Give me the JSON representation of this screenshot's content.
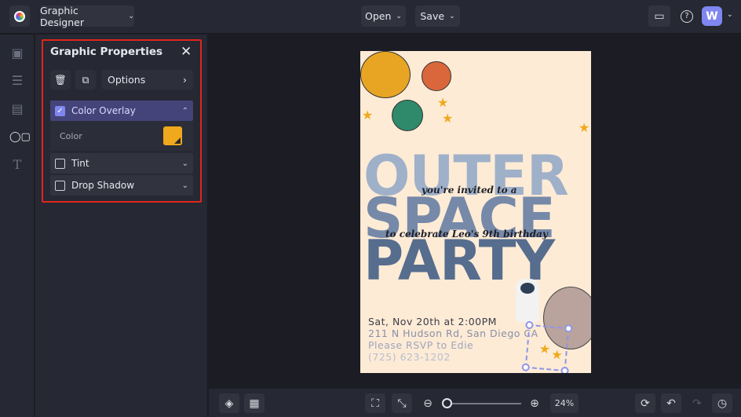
{
  "topbar": {
    "app_selector": "Graphic Designer",
    "open_label": "Open",
    "save_label": "Save",
    "avatar_initial": "W"
  },
  "rail": {
    "icons": [
      "image-icon",
      "sliders-icon",
      "layout-icon",
      "shapes-icon",
      "text-icon"
    ]
  },
  "panel": {
    "title": "Graphic Properties",
    "options_label": "Options",
    "color_overlay": {
      "label": "Color Overlay",
      "checked": true,
      "color_label": "Color",
      "color": "#f0a91c"
    },
    "tint": {
      "label": "Tint",
      "checked": false
    },
    "drop_shadow": {
      "label": "Drop Shadow",
      "checked": false
    }
  },
  "design": {
    "word1": "OUTER",
    "word2": "SPACE",
    "word3": "PARTY",
    "line1": "you're invited to a",
    "line2": "to celebrate Leo's 9th birthday",
    "date": "Sat, Nov 20th at 2:00PM",
    "address": "211 N Hudson Rd, San Diego CA",
    "rsvp": "Please RSVP to Edie",
    "phone": "(725) 623-1202"
  },
  "bottombar": {
    "zoom": "24%",
    "zoom_fraction": 0.05
  },
  "colors": {
    "accent": "#5b5fc7",
    "highlight": "#e0261b",
    "overlay": "#f0a91c"
  }
}
